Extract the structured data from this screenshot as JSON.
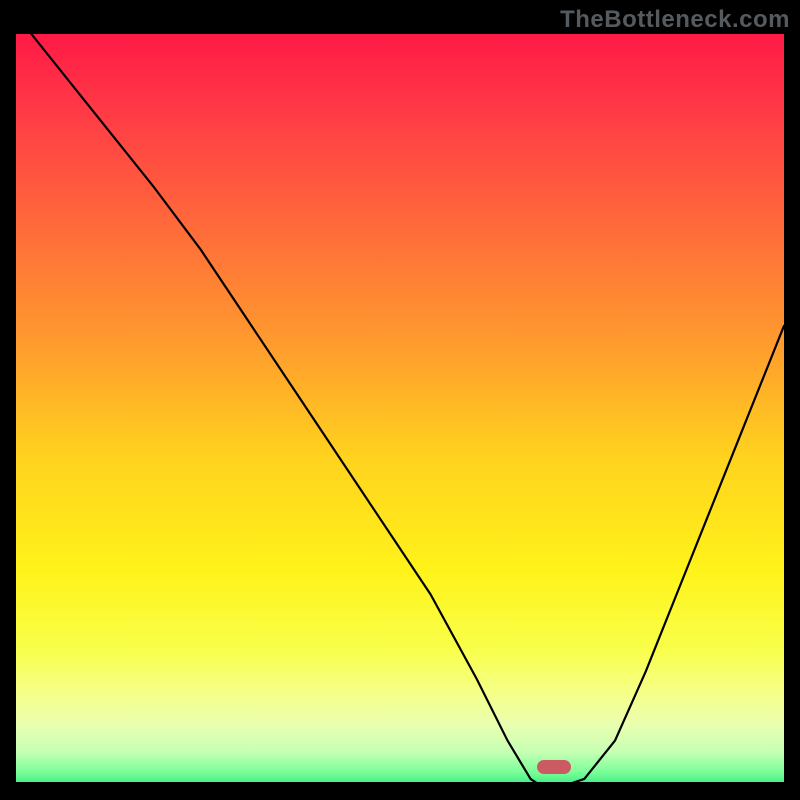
{
  "watermark": "TheBottleneck.com",
  "colors": {
    "marker": "#cb5a63",
    "curve": "#000000",
    "gradient_stops": [
      {
        "offset": 0.0,
        "color": "#ff1a46"
      },
      {
        "offset": 0.1,
        "color": "#ff3a46"
      },
      {
        "offset": 0.25,
        "color": "#ff6a3a"
      },
      {
        "offset": 0.4,
        "color": "#ff9a2e"
      },
      {
        "offset": 0.55,
        "color": "#ffd21e"
      },
      {
        "offset": 0.7,
        "color": "#fff31a"
      },
      {
        "offset": 0.8,
        "color": "#f8ff4a"
      },
      {
        "offset": 0.86,
        "color": "#f5ff8a"
      },
      {
        "offset": 0.9,
        "color": "#e9ffb0"
      },
      {
        "offset": 0.935,
        "color": "#c6ffb4"
      },
      {
        "offset": 0.96,
        "color": "#7eff9a"
      },
      {
        "offset": 0.985,
        "color": "#22e479"
      },
      {
        "offset": 1.0,
        "color": "#18d66f"
      }
    ]
  },
  "chart_data": {
    "type": "line",
    "title": "",
    "xlabel": "",
    "ylabel": "",
    "xlim": [
      0,
      100
    ],
    "ylim": [
      0,
      100
    ],
    "grid": false,
    "series": [
      {
        "name": "bottleneck-curve",
        "x": [
          2,
          10,
          18,
          24,
          30,
          36,
          42,
          48,
          54,
          60,
          64,
          67,
          68.5,
          71,
          74,
          78,
          82,
          86,
          90,
          94,
          98,
          100
        ],
        "y": [
          100,
          90,
          80,
          72,
          63,
          54,
          45,
          36,
          27,
          16,
          8,
          3,
          2,
          2,
          3,
          8,
          17,
          27,
          37,
          47,
          57,
          62
        ]
      }
    ],
    "flat_segment": {
      "x_start": 67,
      "x_end": 74,
      "y": 2
    },
    "marker": {
      "x": 70,
      "y": 2
    },
    "legend": false
  }
}
